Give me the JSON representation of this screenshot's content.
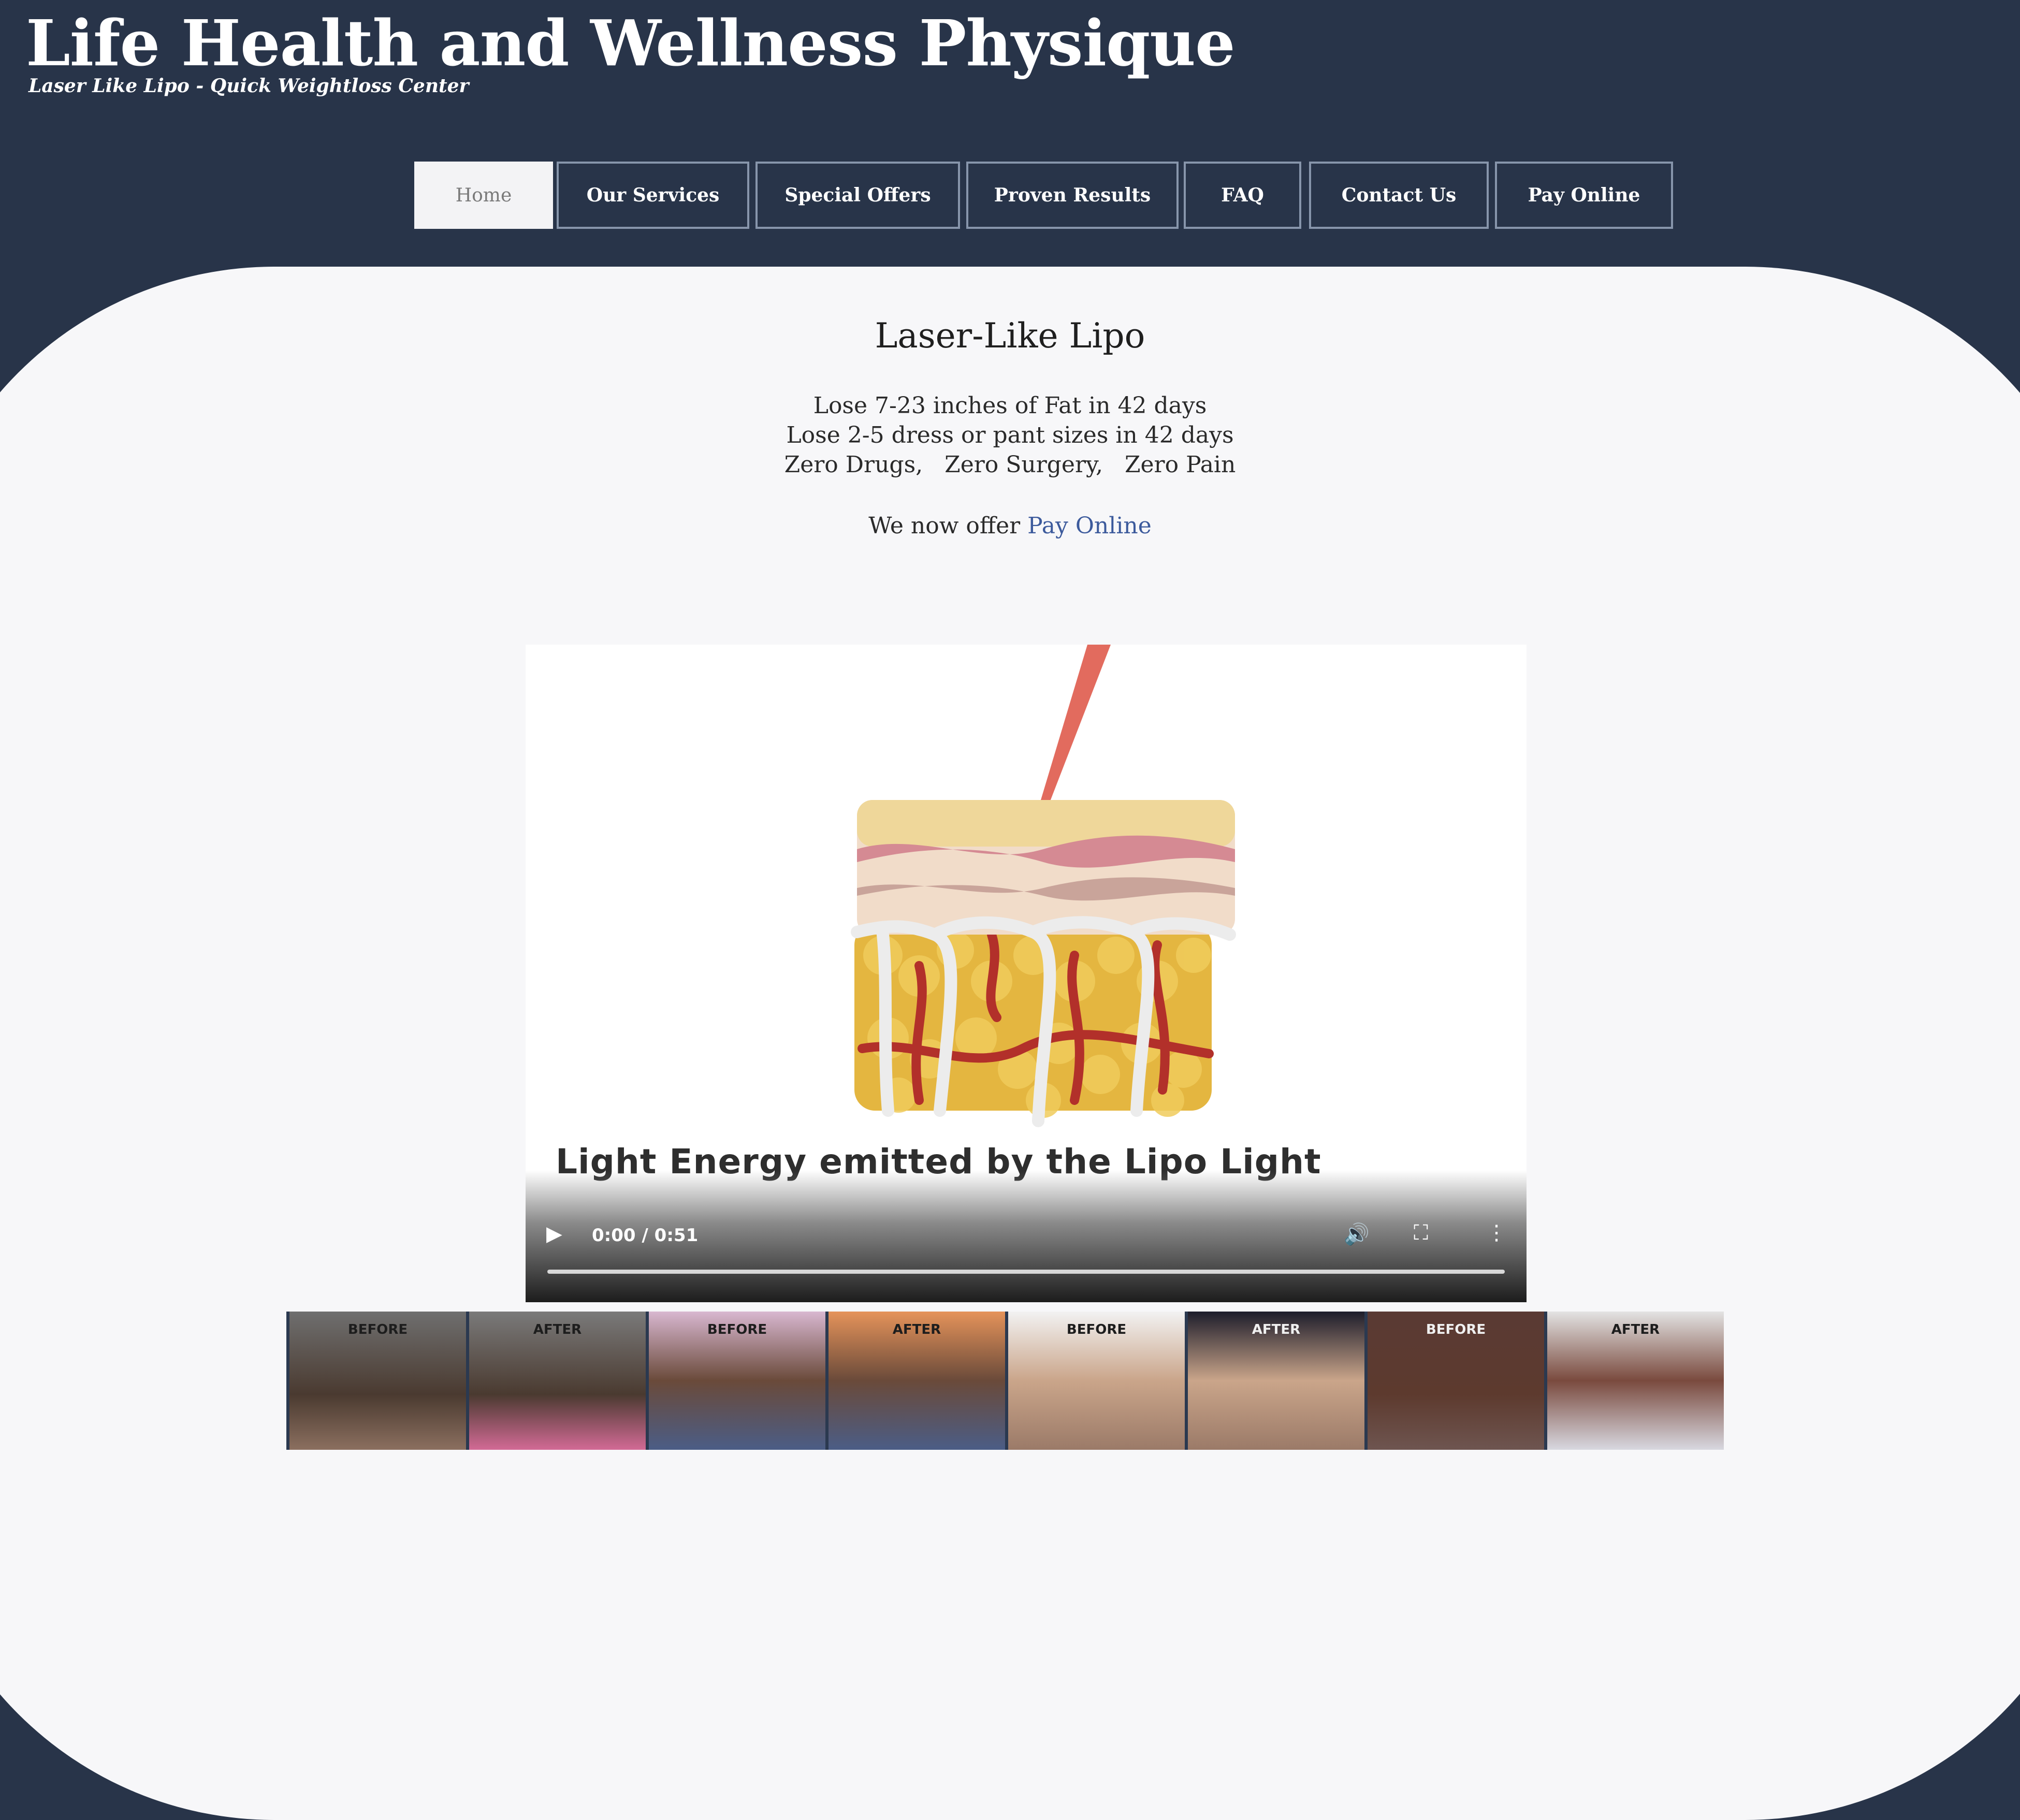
{
  "site": {
    "title": "Life Health and Wellness Physique",
    "tagline": "Laser Like Lipo - Quick Weightloss Center"
  },
  "nav": {
    "items": [
      {
        "label": "Home",
        "active": true
      },
      {
        "label": "Our Services",
        "active": false
      },
      {
        "label": "Special Offers",
        "active": false
      },
      {
        "label": "Proven Results",
        "active": false
      },
      {
        "label": "FAQ",
        "active": false
      },
      {
        "label": "Contact Us",
        "active": false
      },
      {
        "label": "Pay Online",
        "active": false
      }
    ]
  },
  "main": {
    "heading": "Laser-Like Lipo",
    "lines": [
      "Lose 7-23 inches of Fat in 42 days",
      "Lose 2-5 dress or pant sizes in 42 days",
      "Zero Drugs,   Zero Surgery,   Zero Pain"
    ],
    "pay_prefix": "We now offer ",
    "pay_link": "Pay Online"
  },
  "video": {
    "caption": "Light Energy emitted by the Lipo Light",
    "time": "0:00 / 0:51",
    "progress": 0,
    "icons": [
      "play-icon",
      "volume-icon",
      "fullscreen-icon",
      "more-options-icon"
    ]
  },
  "gallery": {
    "thumbnails": [
      {
        "label": "BEFORE"
      },
      {
        "label": "AFTER"
      },
      {
        "label": "BEFORE"
      },
      {
        "label": "AFTER"
      },
      {
        "label": "BEFORE"
      },
      {
        "label": "AFTER"
      },
      {
        "label": "BEFORE"
      },
      {
        "label": "AFTER"
      }
    ]
  },
  "colors": {
    "background": "#283449",
    "content": "#f7f7f9",
    "link": "#3c5a9c",
    "nav_border": "#8795ab"
  }
}
